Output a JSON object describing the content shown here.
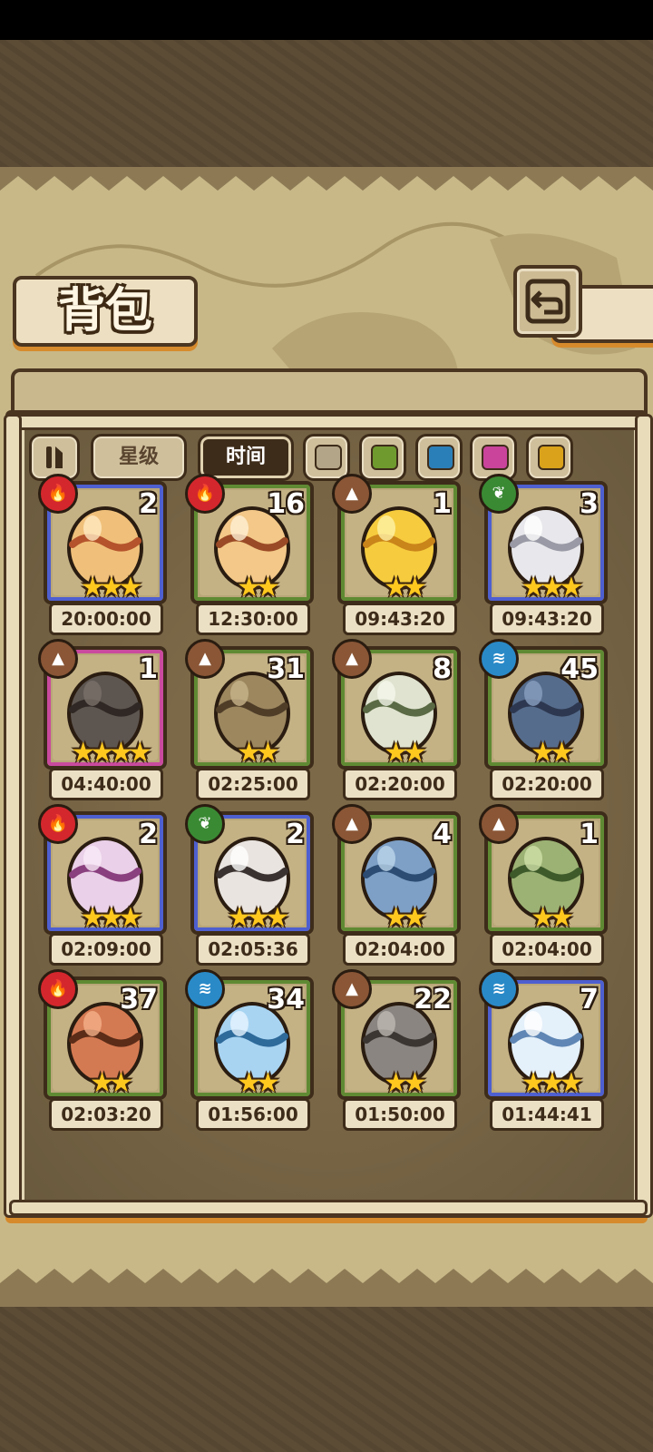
{
  "title": "背包",
  "toolbar": {
    "sort_star_label": "星级",
    "sort_time_label": "时间",
    "active_sort": "时间",
    "color_filters": [
      "#b3a587",
      "#6e9a2e",
      "#2b7fb8",
      "#c9449a",
      "#d9a21a"
    ]
  },
  "colors": {
    "fire": "#d4272d",
    "earth": "#8a5636",
    "leaf": "#3a8a34",
    "water": "#2a8ac8",
    "rarity_blue": "#4e5fcf",
    "rarity_green": "#5f8a33",
    "rarity_pink": "#c94a9e"
  },
  "items": [
    {
      "element": "fire",
      "count": "2",
      "stars": "★★★",
      "timer": "20:00:00",
      "egg": "caramel-sprout-egg"
    },
    {
      "element": "fire",
      "count": "16",
      "stars": "★★",
      "timer": "12:30:00",
      "egg": "caramel-egg"
    },
    {
      "element": "earth",
      "count": "1",
      "stars": "★★",
      "timer": "09:43:20",
      "egg": "golden-egg"
    },
    {
      "element": "leaf",
      "count": "3",
      "stars": "★★★",
      "timer": "09:43:20",
      "egg": "rainbow-gem-egg"
    },
    {
      "element": "earth",
      "count": "1",
      "stars": "★★★★",
      "timer": "04:40:00",
      "egg": "shadow-creature-egg"
    },
    {
      "element": "earth",
      "count": "31",
      "stars": "★★",
      "timer": "02:25:00",
      "egg": "vine-wrapped-egg"
    },
    {
      "element": "earth",
      "count": "8",
      "stars": "★★",
      "timer": "02:20:00",
      "egg": "ringed-egg"
    },
    {
      "element": "water",
      "count": "45",
      "stars": "★★",
      "timer": "02:20:00",
      "egg": "shell-egg"
    },
    {
      "element": "fire",
      "count": "2",
      "stars": "★★★",
      "timer": "02:09:00",
      "egg": "mushroom-egg"
    },
    {
      "element": "leaf",
      "count": "2",
      "stars": "★★★",
      "timer": "02:05:36",
      "egg": "spiked-collar-egg"
    },
    {
      "element": "earth",
      "count": "4",
      "stars": "★★",
      "timer": "02:04:00",
      "egg": "fin-egg"
    },
    {
      "element": "earth",
      "count": "1",
      "stars": "★★",
      "timer": "02:04:00",
      "egg": "leaf-sprout-egg"
    },
    {
      "element": "fire",
      "count": "37",
      "stars": "★★",
      "timer": "02:03:20",
      "egg": "lava-egg"
    },
    {
      "element": "water",
      "count": "34",
      "stars": "★★",
      "timer": "01:56:00",
      "egg": "droplet-egg"
    },
    {
      "element": "earth",
      "count": "22",
      "stars": "★★",
      "timer": "01:50:00",
      "egg": "feather-egg"
    },
    {
      "element": "water",
      "count": "7",
      "stars": "★★★",
      "timer": "01:44:41",
      "egg": "cloud-egg"
    }
  ]
}
